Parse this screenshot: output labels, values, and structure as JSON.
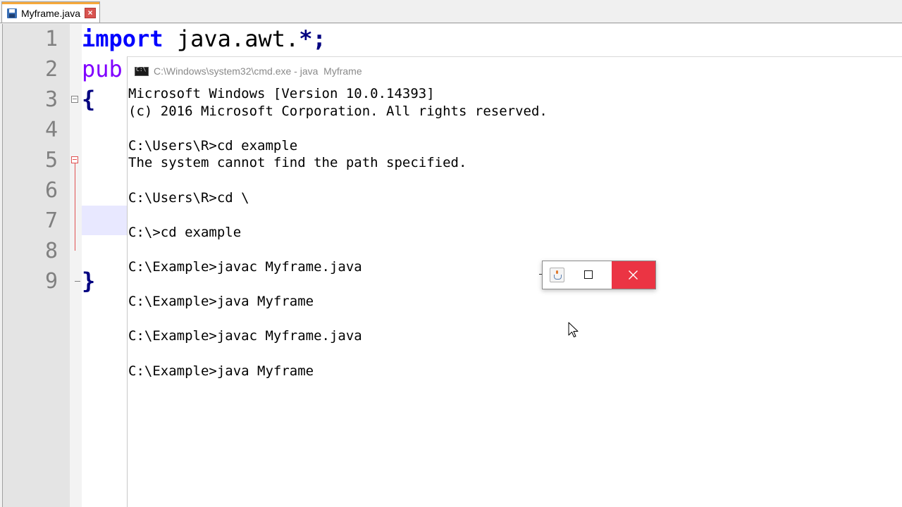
{
  "editor": {
    "tab": {
      "filename": "Myframe.java"
    },
    "line_numbers": [
      "1",
      "2",
      "3",
      "4",
      "5",
      "6",
      "7",
      "8",
      "9"
    ],
    "code": {
      "line1_keyword": "import",
      "line1_rest": " java.awt.",
      "line1_star": "*;",
      "line2_partial": "pub",
      "line3_brace": "{",
      "line9_brace": "}"
    }
  },
  "cmd": {
    "title": "C:\\Windows\\system32\\cmd.exe - java  Myframe",
    "lines": [
      "Microsoft Windows [Version 10.0.14393]",
      "(c) 2016 Microsoft Corporation. All rights reserved.",
      "",
      "C:\\Users\\R>cd example",
      "The system cannot find the path specified.",
      "",
      "C:\\Users\\R>cd \\",
      "",
      "C:\\>cd example",
      "",
      "C:\\Example>javac Myframe.java",
      "",
      "C:\\Example>java Myframe",
      "",
      "C:\\Example>javac Myframe.java",
      "",
      "C:\\Example>java Myframe"
    ]
  },
  "icons": {
    "tab_save": "save-icon",
    "tab_close": "close-icon",
    "cmd": "cmd-icon",
    "java_frame": "java-coffee-icon",
    "maximize": "maximize-icon",
    "close": "close-icon",
    "cursor": "mouse-pointer-icon"
  },
  "colors": {
    "tab_accent": "#f7a93a",
    "keyword_import": "#0000ff",
    "keyword_public": "#8000ff",
    "close_button": "#e81123",
    "current_line": "#e8e8ff"
  }
}
